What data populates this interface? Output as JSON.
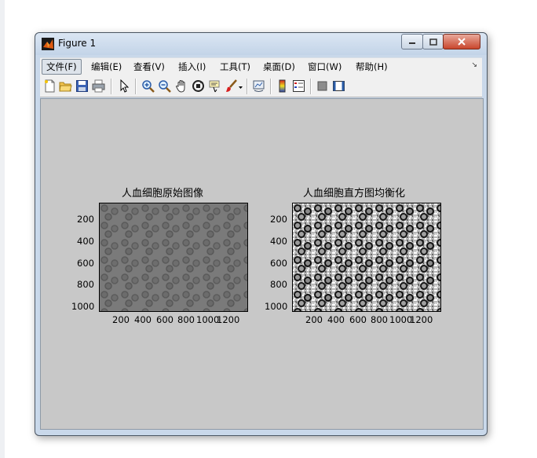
{
  "window": {
    "title": "Figure 1"
  },
  "menu": [
    {
      "label": "文件(F)"
    },
    {
      "label": "编辑(E)"
    },
    {
      "label": "查看(V)"
    },
    {
      "label": "插入(I)"
    },
    {
      "label": "工具(T)"
    },
    {
      "label": "桌面(D)"
    },
    {
      "label": "窗口(W)"
    },
    {
      "label": "帮助(H)"
    }
  ],
  "toolbar_icons": [
    "new-figure-icon",
    "open-file-icon",
    "save-icon",
    "print-icon",
    "select-arrow-icon",
    "zoom-in-icon",
    "zoom-out-icon",
    "pan-hand-icon",
    "rotate-3d-icon",
    "data-cursor-icon",
    "brush-icon",
    "brush-dropdown-icon",
    "link-plot-icon",
    "colorbar-icon",
    "legend-icon",
    "hide-plot-tools-icon",
    "show-plot-tools-icon"
  ],
  "axes": [
    {
      "title": "人血细胞原始图像",
      "yticks": [
        "200",
        "400",
        "600",
        "800",
        "1000"
      ],
      "xticks": [
        "200",
        "400",
        "600",
        "800",
        "1000",
        "1200"
      ]
    },
    {
      "title": "人血细胞直方图均衡化",
      "yticks": [
        "200",
        "400",
        "600",
        "800",
        "1000"
      ],
      "xticks": [
        "200",
        "400",
        "600",
        "800",
        "1000",
        "1200"
      ]
    }
  ]
}
